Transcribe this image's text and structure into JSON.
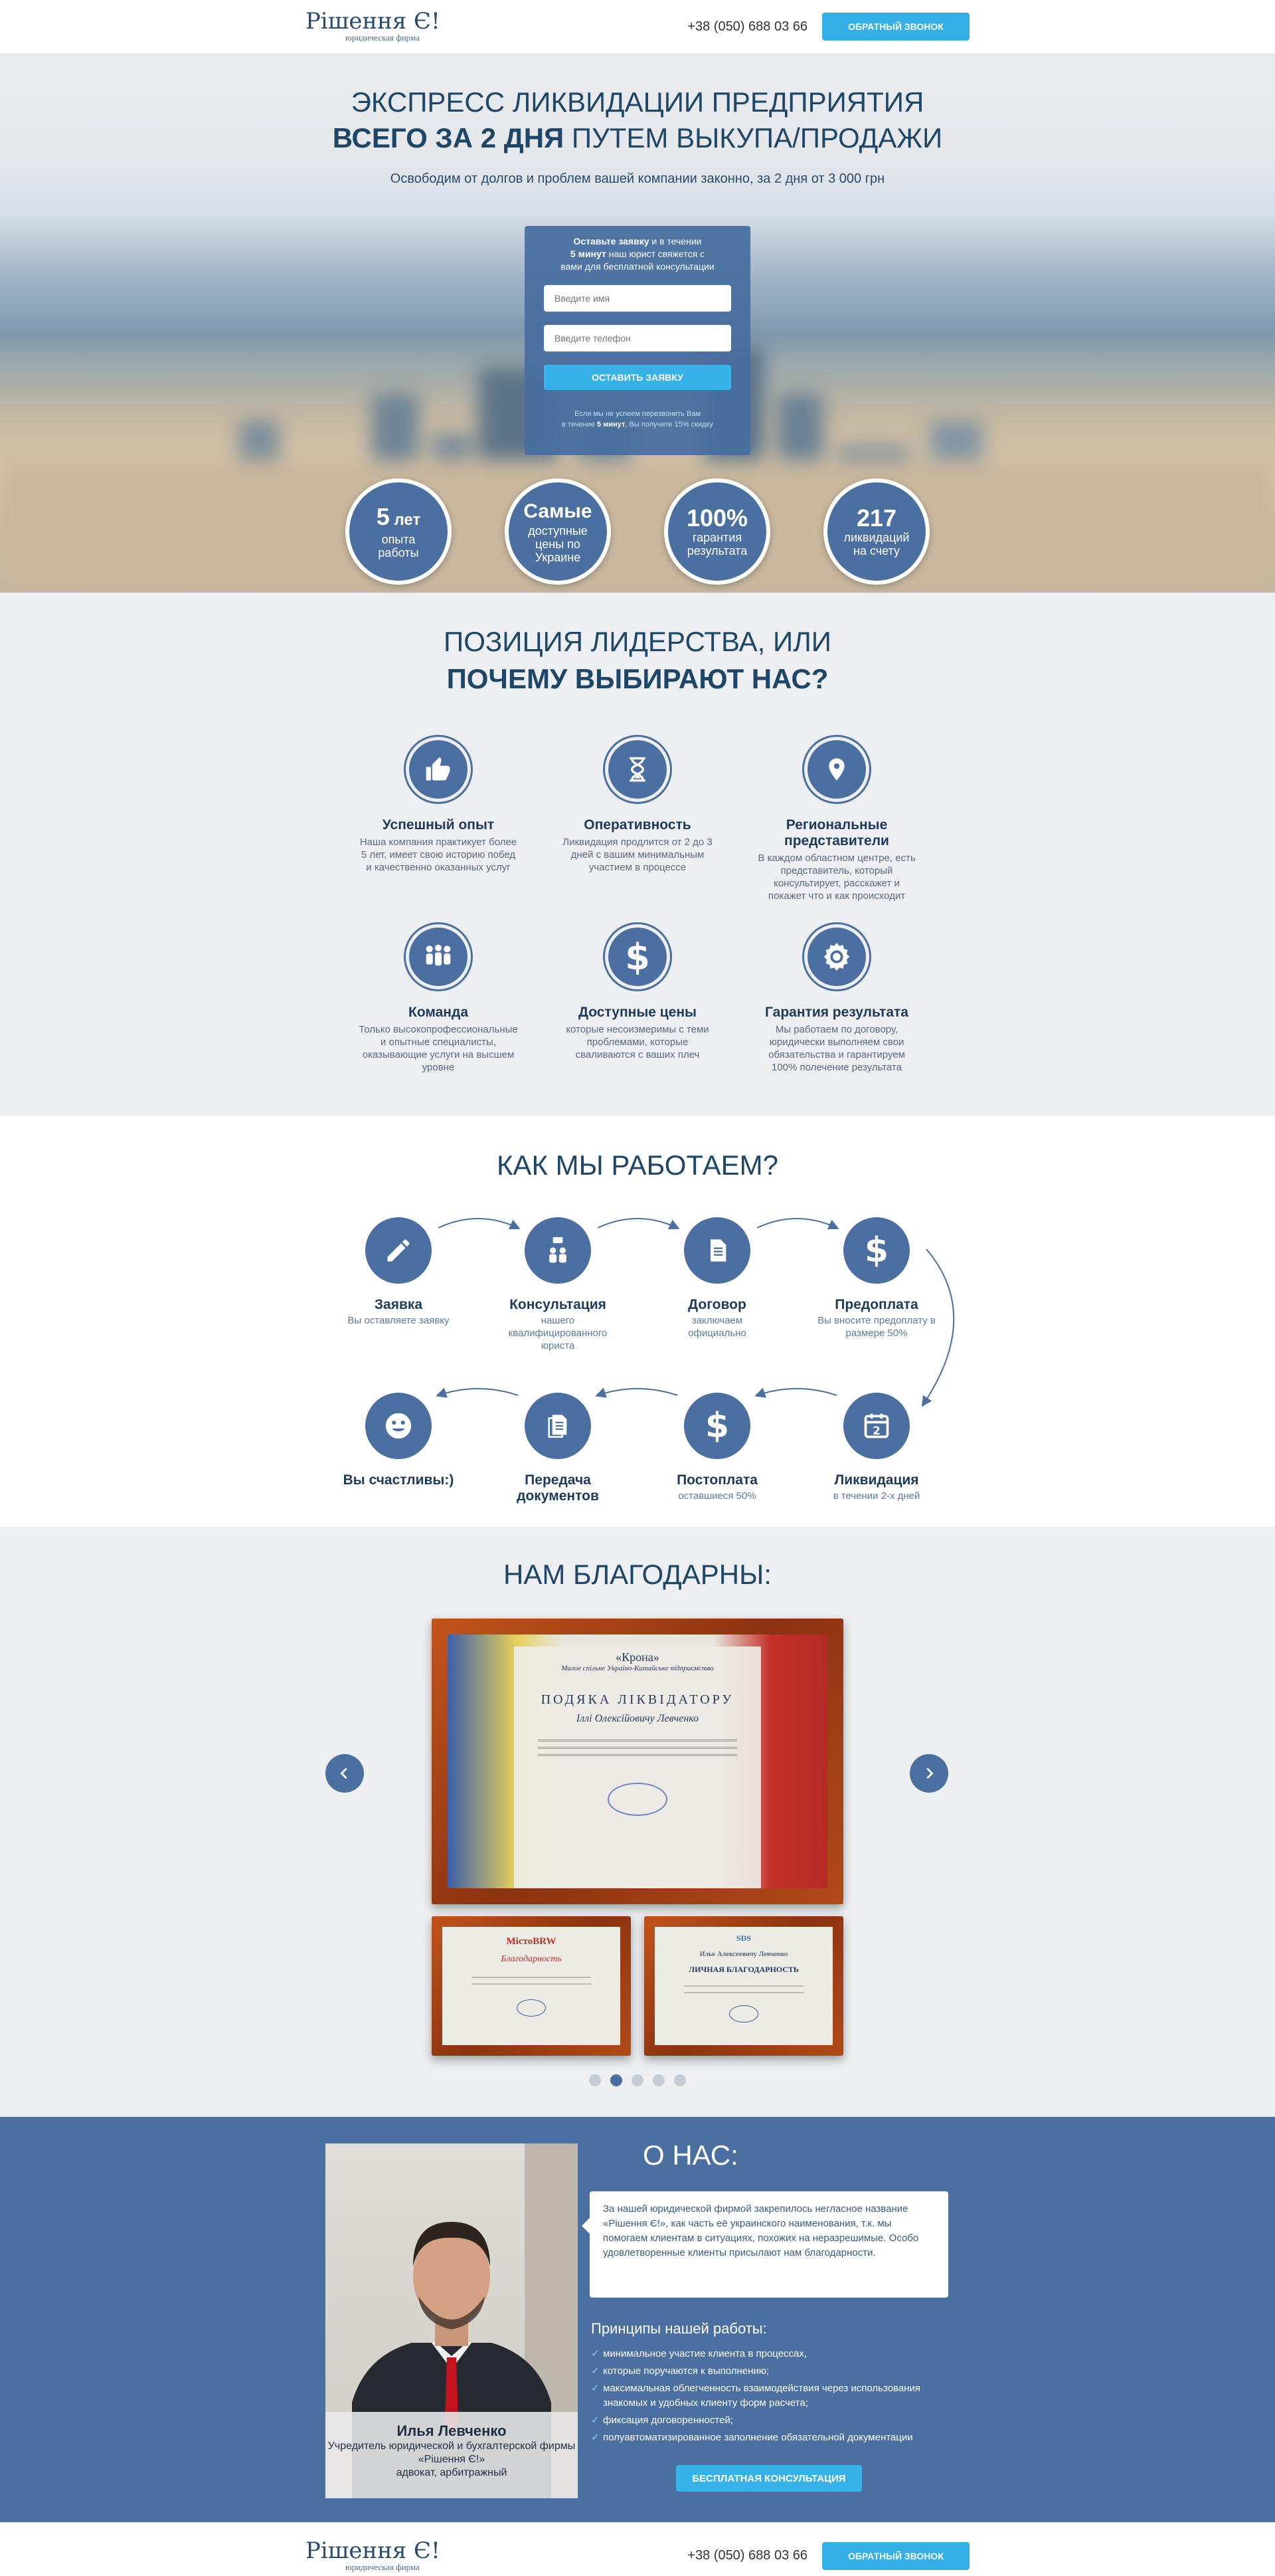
{
  "header": {
    "logo": "Рішення Є!",
    "logo_sub": "юридическая фирма",
    "phone": "+38 (050) 688 03 66",
    "callback": "ОБРАТНЫЙ ЗВОНОК"
  },
  "hero": {
    "title1": "ЭКСПРЕСС ЛИКВИДАЦИИ ПРЕДПРИЯТИЯ",
    "title2_bold": "ВСЕГО ЗА 2 ДНЯ",
    "title2_rest": " ПУТЕМ ВЫКУПА/ПРОДАЖИ",
    "subtitle": "Освободим от долгов и проблем вашей компании законно, за 2 дня от 3 000 грн",
    "form": {
      "head_bold": "Оставьте заявку",
      "head_1": " и в течении",
      "head_2_bold": "5 минут",
      "head_2": " наш юрист свяжется с",
      "head_3": "вами  для бесплатной консультации",
      "name_ph": "Введите имя",
      "phone_ph": "Введите телефон",
      "submit": "ОСТАВИТЬ ЗАЯВКУ",
      "note1": "Если мы не успеем перезвонить Вам",
      "note2_a": "в течение ",
      "note2_b": "5 минут",
      "note2_c": ", Вы получите 15% скидку"
    },
    "stats": [
      {
        "big": "5",
        "big_suffix": " лет",
        "l1": "опыта",
        "l2": "работы"
      },
      {
        "big": "Самые",
        "l1": "доступные",
        "l2": "цены по",
        "l3": "Украине"
      },
      {
        "big": "100%",
        "l1": "гарантия",
        "l2": "результата"
      },
      {
        "big": "217",
        "l1": "ликвидаций",
        "l2": "на счету"
      }
    ]
  },
  "why": {
    "title1": "ПОЗИЦИЯ ЛИДЕРСТВА, ИЛИ",
    "title2": "ПОЧЕМУ ВЫБИРАЮТ НАС?",
    "items": [
      {
        "title": "Успешный опыт",
        "text": "Наша компания практикует более 5 лет, имеет свою историю побед и качественно оказанных услуг",
        "icon": "thumbs-up-icon"
      },
      {
        "title": "Оперативность",
        "text": "Ликвидация продлится от 2 до 3 дней с вашим минимальным участием в процессе",
        "icon": "hourglass-icon"
      },
      {
        "title": "Региональные представители",
        "text": "В каждом областном центре, есть представитель, который консультирует, расскажет и покажет что и как происходит",
        "icon": "map-pin-icon"
      },
      {
        "title": "Команда",
        "text": "Только высокопрофессиональные и опытные специалисты, оказывающие услуги на высшем уровне",
        "icon": "team-icon"
      },
      {
        "title": "Доступные цены",
        "text": "которые несоизмеримы с теми проблемами, которые сваливаются с ваших плеч",
        "icon": "dollar-icon"
      },
      {
        "title": "Гарантия результата",
        "text": "Мы работаем по договору, юридически выполняем свои обязательства и гарантируем 100% полечение результата",
        "icon": "badge-icon"
      }
    ]
  },
  "how": {
    "title": "КАК МЫ РАБОТАЕМ?",
    "steps": [
      {
        "title": "Заявка",
        "text": "Вы оставляете заявку",
        "icon": "pencil-icon"
      },
      {
        "title": "Консультация",
        "text": "нашего квалифицированного юриста",
        "icon": "consult-icon"
      },
      {
        "title": "Договор",
        "text": "заключаем официально",
        "icon": "document-icon"
      },
      {
        "title": "Предоплата",
        "text": "Вы вносите предоплату в размере 50%",
        "icon": "dollar-icon"
      },
      {
        "title": "Ликвидация",
        "text": "в течении 2-х дней",
        "icon": "calendar-icon"
      },
      {
        "title": "Постоплата",
        "text": "оставшиеся 50%",
        "icon": "dollar-icon"
      },
      {
        "title": "Передача документов",
        "text": "",
        "icon": "documents-icon"
      },
      {
        "title": "Вы счастливы:)",
        "text": "",
        "icon": "smile-icon"
      }
    ]
  },
  "thanks": {
    "title": "НАМ БЛАГОДАРНЫ:",
    "cert_main": {
      "org": "«Крона»",
      "org_sub": "Малое спільне Україно-Китайське підприємство",
      "heading": "ПОДЯКА ЛІКВІДАТОРУ",
      "name": "Іллі Олексійовичу Левченко"
    },
    "cert_left": {
      "brand": "МістоBRW",
      "heading": "Благодарность"
    },
    "cert_right": {
      "brand": "SDS",
      "name": "Илье Алексеевичу Левченко",
      "heading": "ЛИЧНАЯ БЛАГОДАРНОСТЬ"
    },
    "slides": 5,
    "active_slide": 2
  },
  "about": {
    "title": "О НАС:",
    "text": "За нашей юридической фирмой закрепилось негласное название «Рішення Є!», как часть её украинского наименования, т.к. мы помогаем клиентам в ситуациях, похожих на неразрешимые. Особо удовлетворенные клиенты присылают нам благодарности.",
    "principles_title": "Принципы нашей работы:",
    "principles": [
      "минимальное участие клиента в процессах,",
      "которые поручаются к выполнению;",
      "максимальная облегченность взаимодействия через использования знакомых и удобных клиенту форм расчета;",
      "фиксация договоренностей;",
      "полуавтоматизированное заполнение обязательной документации"
    ],
    "person_name": "Илья Левченко",
    "person_role": "Учредитель юридической и бухгалтерской фирмы «Рішення Є!»",
    "person_role2": "адвокат, арбитражный",
    "cta": "БЕСПЛАТНАЯ КОНСУЛЬТАЦИЯ"
  },
  "footer": {
    "logo": "Рішення Є!",
    "logo_sub": "юридическая фирма",
    "phone": "+38 (050) 688 03 66",
    "callback": "ОБРАТНЫЙ ЗВОНОК"
  }
}
